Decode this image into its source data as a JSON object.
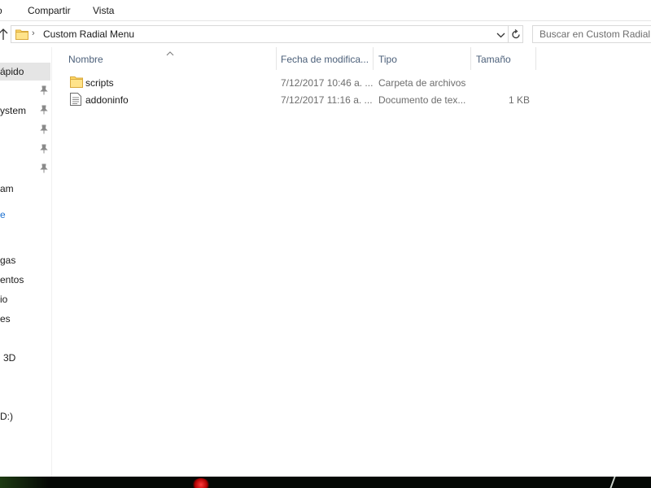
{
  "ribbon": {
    "tabs": [
      {
        "label": "o"
      },
      {
        "label": "Compartir"
      },
      {
        "label": "Vista"
      }
    ]
  },
  "address_bar": {
    "path": "Custom Radial Menu",
    "separator": "›"
  },
  "search": {
    "placeholder": "Buscar en Custom Radial Menu"
  },
  "navpane": {
    "items": [
      {
        "label": "ápido",
        "selected": true
      },
      {
        "label": "",
        "pinned": true
      },
      {
        "label": "ystem",
        "pinned": true
      },
      {
        "label": "",
        "pinned": true
      },
      {
        "label": "",
        "pinned": true
      },
      {
        "label": "",
        "pinned": true
      },
      {
        "label": "am"
      },
      {
        "label": "e"
      },
      {
        "label": "gas"
      },
      {
        "label": "entos"
      },
      {
        "label": "io"
      },
      {
        "label": "es"
      },
      {
        "label": "3D"
      },
      {
        "label": "D:)"
      }
    ]
  },
  "columns": {
    "name": "Nombre",
    "date": "Fecha de modifica...",
    "type": "Tipo",
    "size": "Tamaño"
  },
  "files": [
    {
      "name": "scripts",
      "date": "7/12/2017 10:46 a. ...",
      "type": "Carpeta de archivos",
      "size": "",
      "icon": "folder-icon"
    },
    {
      "name": "addoninfo",
      "date": "7/12/2017 11:16 a. ...",
      "type": "Documento de tex...",
      "size": "1 KB",
      "icon": "text-file-icon"
    }
  ],
  "colors": {
    "header_text": "#4c607a",
    "selection": "#e5e5e5",
    "link_blue": "#1a6fd0",
    "folder_yellow": "#ffd866"
  }
}
